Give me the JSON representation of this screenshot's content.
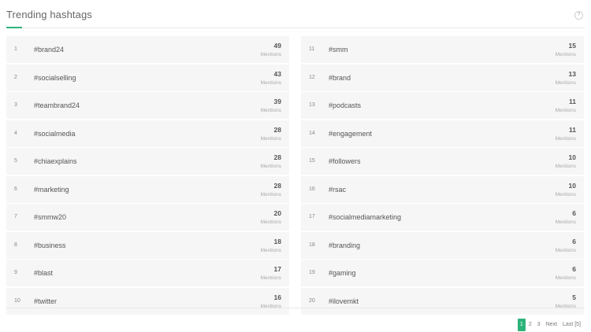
{
  "header": {
    "title": "Trending hashtags",
    "help_icon": "?"
  },
  "accent_color": "#2db37a",
  "mentions_label": "Mentions",
  "left_items": [
    {
      "rank": "1",
      "tag": "#brand24",
      "count": "49"
    },
    {
      "rank": "2",
      "tag": "#socialselling",
      "count": "43"
    },
    {
      "rank": "3",
      "tag": "#teambrand24",
      "count": "39"
    },
    {
      "rank": "4",
      "tag": "#socialmedia",
      "count": "28"
    },
    {
      "rank": "5",
      "tag": "#chiaexplains",
      "count": "28"
    },
    {
      "rank": "6",
      "tag": "#marketing",
      "count": "28"
    },
    {
      "rank": "7",
      "tag": "#smmw20",
      "count": "20"
    },
    {
      "rank": "8",
      "tag": "#business",
      "count": "18"
    },
    {
      "rank": "9",
      "tag": "#blast",
      "count": "17"
    },
    {
      "rank": "10",
      "tag": "#twitter",
      "count": "16"
    }
  ],
  "right_items": [
    {
      "rank": "11",
      "tag": "#smm",
      "count": "15"
    },
    {
      "rank": "12",
      "tag": "#brand",
      "count": "13"
    },
    {
      "rank": "13",
      "tag": "#podcasts",
      "count": "11"
    },
    {
      "rank": "14",
      "tag": "#engagement",
      "count": "11"
    },
    {
      "rank": "15",
      "tag": "#followers",
      "count": "10"
    },
    {
      "rank": "16",
      "tag": "#rsac",
      "count": "10"
    },
    {
      "rank": "17",
      "tag": "#socialmediamarketing",
      "count": "6"
    },
    {
      "rank": "18",
      "tag": "#branding",
      "count": "6"
    },
    {
      "rank": "19",
      "tag": "#gaming",
      "count": "6"
    },
    {
      "rank": "20",
      "tag": "#ilovemkt",
      "count": "5"
    }
  ],
  "pagination": {
    "pages": [
      "1",
      "2",
      "3"
    ],
    "active": "1",
    "next": "Next",
    "last": "Last [5]"
  }
}
